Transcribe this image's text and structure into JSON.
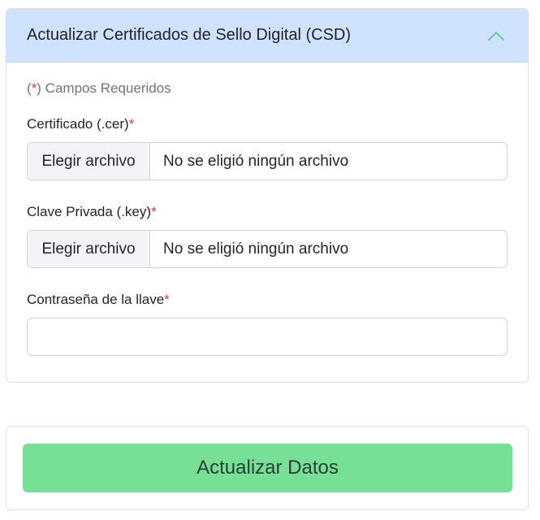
{
  "card": {
    "title": "Actualizar Certificados de Sello Digital (CSD)",
    "collapse_icon": "chevron-up-icon"
  },
  "form": {
    "required_note": {
      "open": "(",
      "star": "*",
      "text": ") Campos Requeridos"
    },
    "required_marker": "*",
    "certificate": {
      "label": "Certificado (.cer)",
      "button_label": "Elegir archivo",
      "file_status": "No se eligió ningún archivo"
    },
    "private_key": {
      "label": "Clave Privada (.key)",
      "button_label": "Elegir archivo",
      "file_status": "No se eligió ningún archivo"
    },
    "password": {
      "label": "Contraseña de la llave",
      "value": ""
    }
  },
  "footer": {
    "submit_label": "Actualizar Datos"
  },
  "colors": {
    "header_bg": "#cfe2ff",
    "required": "#dc3545",
    "submit_bg": "#75e096",
    "chevron": "#5cc489"
  }
}
